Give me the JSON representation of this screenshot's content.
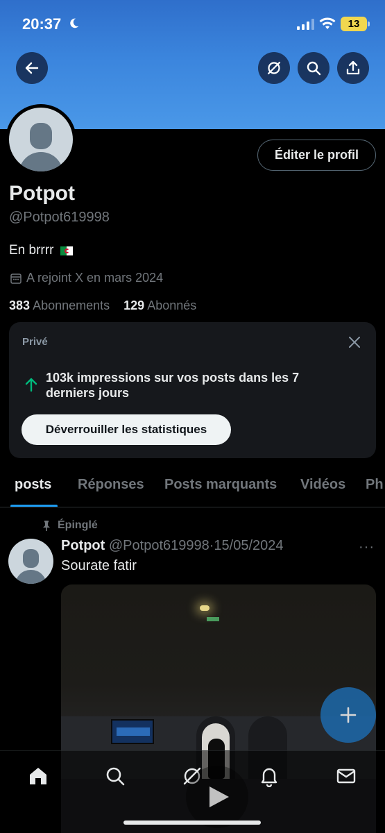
{
  "status_bar": {
    "time": "20:37",
    "battery": "13"
  },
  "header": {
    "back_icon": "arrow-left-icon",
    "grok_icon": "slash-circle-icon",
    "search_icon": "search-icon",
    "share_icon": "share-icon"
  },
  "profile": {
    "edit_label": "Éditer le profil",
    "name": "Potpot",
    "handle": "@Potpot619998",
    "bio": "En brrrr",
    "joined": "A rejoint X en mars 2024",
    "following_count": "383",
    "following_label": "Abonnements",
    "followers_count": "129",
    "followers_label": "Abonnés"
  },
  "private_card": {
    "label": "Privé",
    "impressions": "103k impressions sur vos posts dans les 7 derniers jours",
    "unlock_label": "Déverrouiller les statistiques"
  },
  "tabs": [
    {
      "label": "posts"
    },
    {
      "label": "Réponses"
    },
    {
      "label": "Posts marquants"
    },
    {
      "label": "Vidéos"
    },
    {
      "label": "Ph"
    }
  ],
  "post": {
    "pinned_label": "Épinglé",
    "name": "Potpot",
    "handle": "@Potpot619998",
    "separator": "·",
    "date": "15/05/2024",
    "more": "···",
    "text": "Sourate fatir"
  },
  "colors": {
    "accent": "#1d9bf0",
    "banner": "#3b85dd",
    "up_arrow": "#00ba7c"
  }
}
